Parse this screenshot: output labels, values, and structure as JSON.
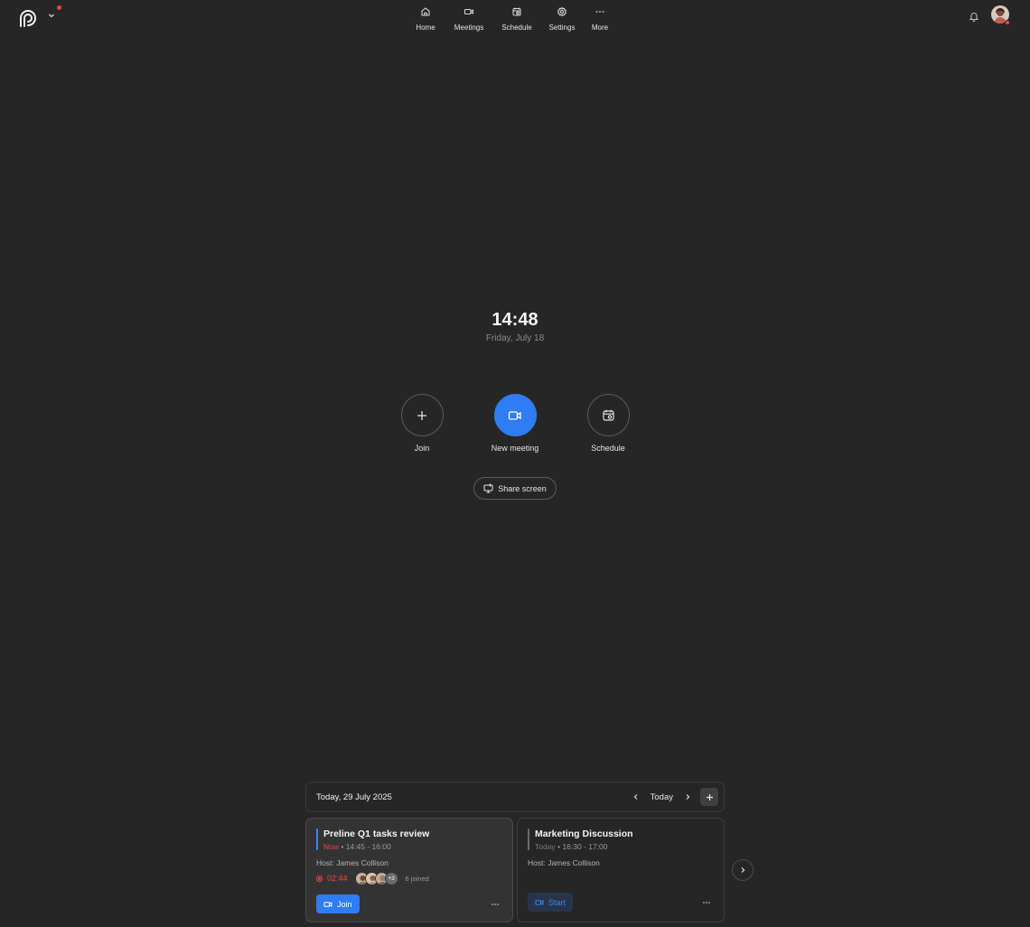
{
  "nav": {
    "items": [
      {
        "label": "Home",
        "icon": "home-icon"
      },
      {
        "label": "Meetings",
        "icon": "video-icon"
      },
      {
        "label": "Schedule",
        "icon": "calendar-icon"
      },
      {
        "label": "Settings",
        "icon": "gear-icon"
      },
      {
        "label": "More",
        "icon": "more-icon"
      }
    ]
  },
  "clock": {
    "time": "14:48",
    "date": "Friday, July 18"
  },
  "actions": {
    "join": "Join",
    "new_meeting": "New meeting",
    "schedule": "Schedule",
    "share_screen": "Share screen"
  },
  "calendar": {
    "date_label": "Today, 29 July 2025",
    "today_button": "Today",
    "meetings": [
      {
        "title": "Preline Q1 tasks review",
        "status": "Now",
        "time": "14:45 - 16:00",
        "host": "Host: James Collison",
        "elapsed": "02:44",
        "extra_count": "+3",
        "joined": "6 joined",
        "action": "Join",
        "accent": "#3b82f6",
        "status_color": "#ef4444"
      },
      {
        "title": "Marketing Discussion",
        "status": "Today",
        "time": "16:30 - 17:00",
        "host": "Host: James Collison",
        "action": "Start",
        "accent": "#6b6b6b",
        "status_color": "#8a8a8a"
      }
    ]
  },
  "colors": {
    "background": "#262626",
    "accent": "#2e7cf6",
    "alert": "#ef4444"
  }
}
